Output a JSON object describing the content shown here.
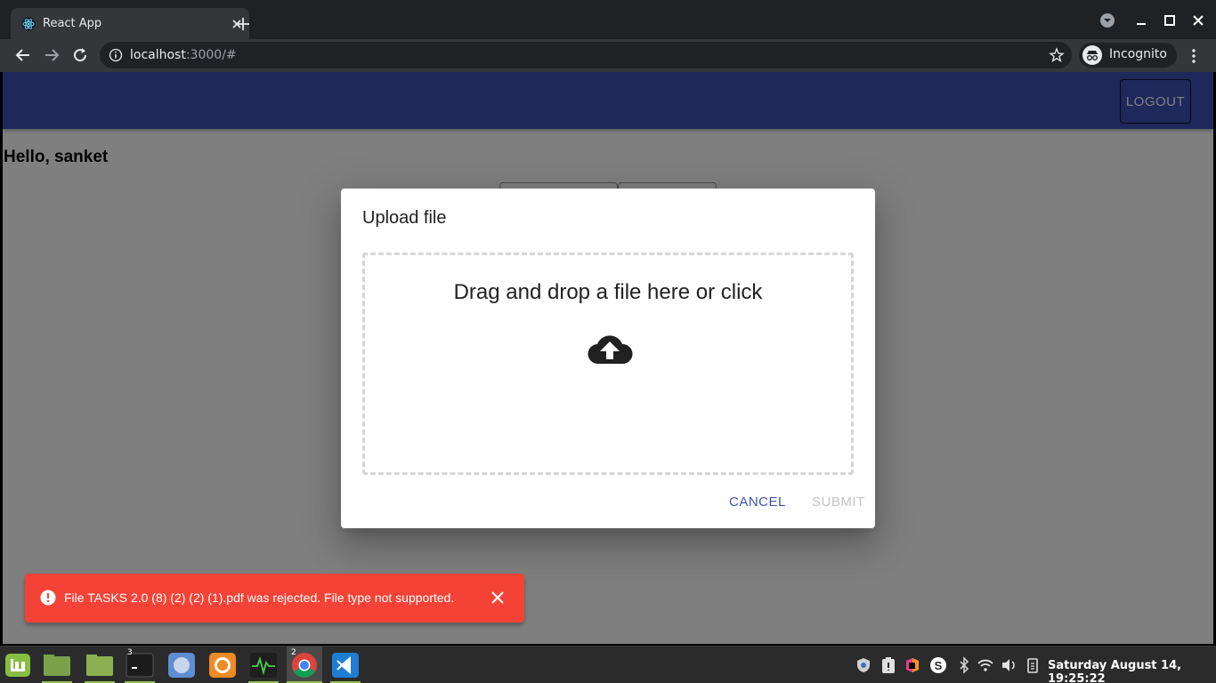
{
  "browser": {
    "tab_title": "React App",
    "url_host": "localhost",
    "url_path": ":3000/#",
    "profile_label": "Incognito"
  },
  "app": {
    "logout_label": "LOGOUT",
    "greeting": "Hello, sanket",
    "accent_color": "#3f51b5"
  },
  "dialog": {
    "title": "Upload file",
    "dropzone_text": "Drag and drop a file here or click",
    "dropzone_icon": "cloud-upload-icon",
    "cancel_label": "CANCEL",
    "submit_label": "SUBMIT",
    "submit_disabled": true
  },
  "snackbar": {
    "message": "File TASKS 2.0 (8) (2) (2) (1).pdf was rejected. File type not supported.",
    "type": "error",
    "color": "#f44336"
  },
  "taskbar": {
    "apps": [
      {
        "name": "mint-menu",
        "badge": ""
      },
      {
        "name": "files-desktop",
        "badge": ""
      },
      {
        "name": "file-manager",
        "badge": ""
      },
      {
        "name": "terminal",
        "badge": "3"
      },
      {
        "name": "chromium",
        "badge": ""
      },
      {
        "name": "firefox",
        "badge": ""
      },
      {
        "name": "system-monitor",
        "badge": ""
      },
      {
        "name": "chrome",
        "badge": "2"
      },
      {
        "name": "vscode",
        "badge": ""
      }
    ],
    "clock": "Saturday August 14, 19:25:22"
  }
}
